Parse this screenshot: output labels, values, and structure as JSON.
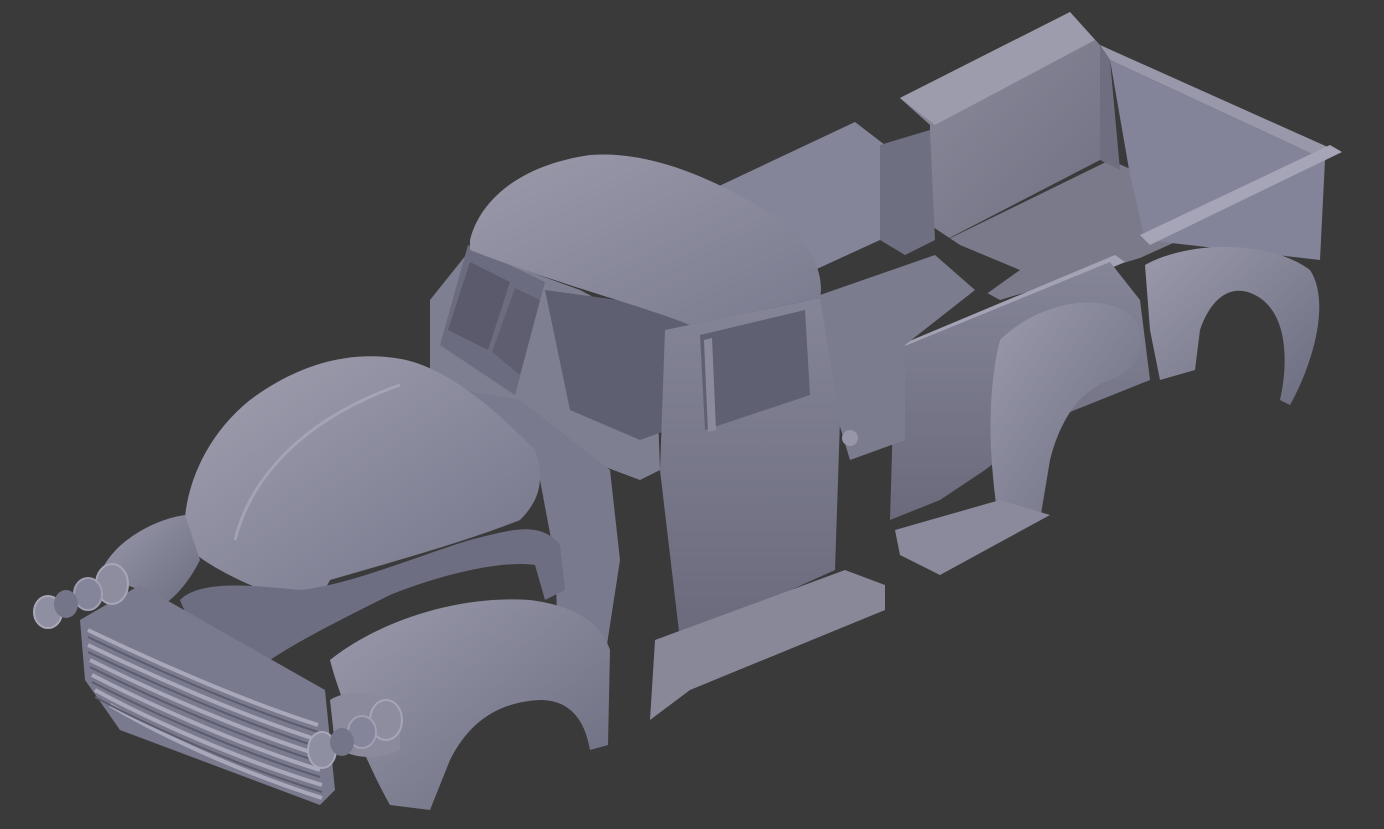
{
  "viewport": {
    "background": "#3a3a3a",
    "object": {
      "kind": "3d-model",
      "depiction": "truck-body-exploded-view",
      "base_color": "#8a8a9a",
      "light_color": "#a2a2b2",
      "dark_color": "#5f5f6f"
    }
  }
}
